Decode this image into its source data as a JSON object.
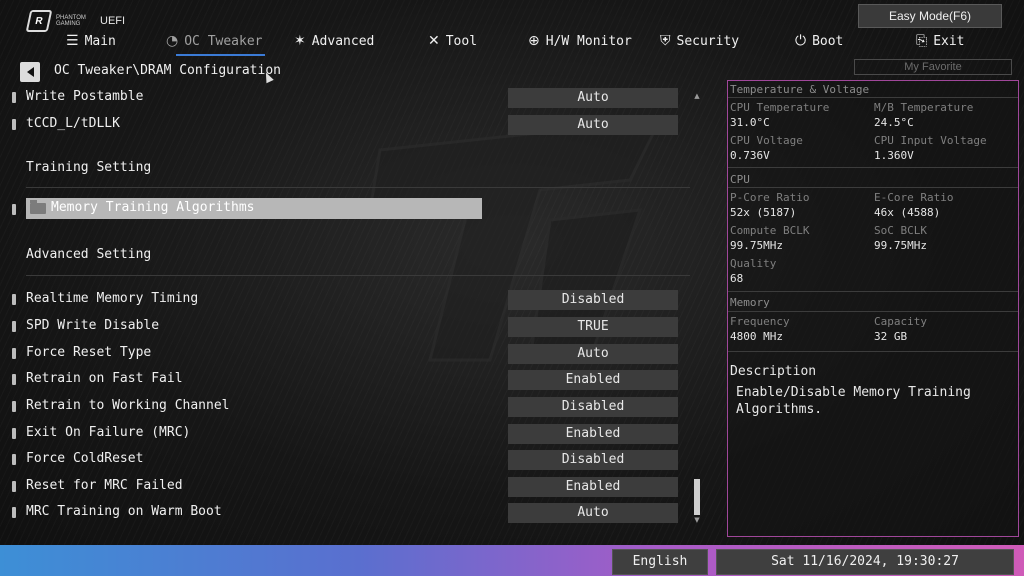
{
  "brand": {
    "logo_letter": "R",
    "logo_text": "PHANTOM GAMING",
    "uefi": "UEFI"
  },
  "easy_mode_label": "Easy Mode(F6)",
  "nav": [
    {
      "label": "Main",
      "icon": "list-icon",
      "glyph": "☰"
    },
    {
      "label": "OC Tweaker",
      "icon": "oc-gauge-icon",
      "glyph": "◔"
    },
    {
      "label": "Advanced",
      "icon": "advanced-star-icon",
      "glyph": "✶"
    },
    {
      "label": "Tool",
      "icon": "tool-icon",
      "glyph": "✕"
    },
    {
      "label": "H/W Monitor",
      "icon": "monitor-icon",
      "glyph": "⊕"
    },
    {
      "label": "Security",
      "icon": "shield-icon",
      "glyph": "⛨"
    },
    {
      "label": "Boot",
      "icon": "power-icon",
      "glyph": "⏻"
    },
    {
      "label": "Exit",
      "icon": "exit-icon",
      "glyph": "⎘"
    }
  ],
  "my_favorite": "My Favorite",
  "breadcrumb": "OC Tweaker\\DRAM Configuration",
  "settings_top": [
    {
      "label": "Write Postamble",
      "value": "Auto"
    },
    {
      "label": "tCCD_L/tDLLK",
      "value": "Auto"
    }
  ],
  "section_training": "Training Setting",
  "selected_item": "Memory Training Algorithms",
  "section_advanced": "Advanced Setting",
  "settings_advanced": [
    {
      "label": "Realtime Memory Timing",
      "value": "Disabled"
    },
    {
      "label": "SPD Write Disable",
      "value": "TRUE"
    },
    {
      "label": "Force Reset Type",
      "value": "Auto"
    },
    {
      "label": "Retrain on Fast Fail",
      "value": "Enabled"
    },
    {
      "label": "Retrain to Working Channel",
      "value": "Disabled"
    },
    {
      "label": "Exit On Failure (MRC)",
      "value": "Enabled"
    },
    {
      "label": "Force ColdReset",
      "value": "Disabled"
    },
    {
      "label": "Reset for MRC Failed",
      "value": "Enabled"
    },
    {
      "label": "MRC Training on Warm Boot",
      "value": "Auto"
    }
  ],
  "panel": {
    "temp_title": "Temperature & Voltage",
    "cpu_temp_label": "CPU Temperature",
    "cpu_temp": "31.0°C",
    "mb_temp_label": "M/B Temperature",
    "mb_temp": "24.5°C",
    "cpu_volt_label": "CPU Voltage",
    "cpu_volt": "0.736V",
    "cpu_in_volt_label": "CPU Input Voltage",
    "cpu_in_volt": "1.360V",
    "cpu_title": "CPU",
    "pcore_label": "P-Core Ratio",
    "pcore": "52x (5187)",
    "ecore_label": "E-Core Ratio",
    "ecore": "46x (4588)",
    "compute_bclk_label": "Compute BCLK",
    "compute_bclk": "99.75MHz",
    "soc_bclk_label": "SoC BCLK",
    "soc_bclk": "99.75MHz",
    "quality_label": "Quality",
    "quality": "68",
    "mem_title": "Memory",
    "freq_label": "Frequency",
    "freq": "4800 MHz",
    "cap_label": "Capacity",
    "cap": "32 GB",
    "desc_title": "Description",
    "desc_text": "Enable/Disable Memory Training Algorithms."
  },
  "footer": {
    "language": "English",
    "datetime": "Sat 11/16/2024, 19:30:27"
  },
  "colors": {
    "accent_blue": "#3b7bd6",
    "panel_border": "#a0479a"
  }
}
